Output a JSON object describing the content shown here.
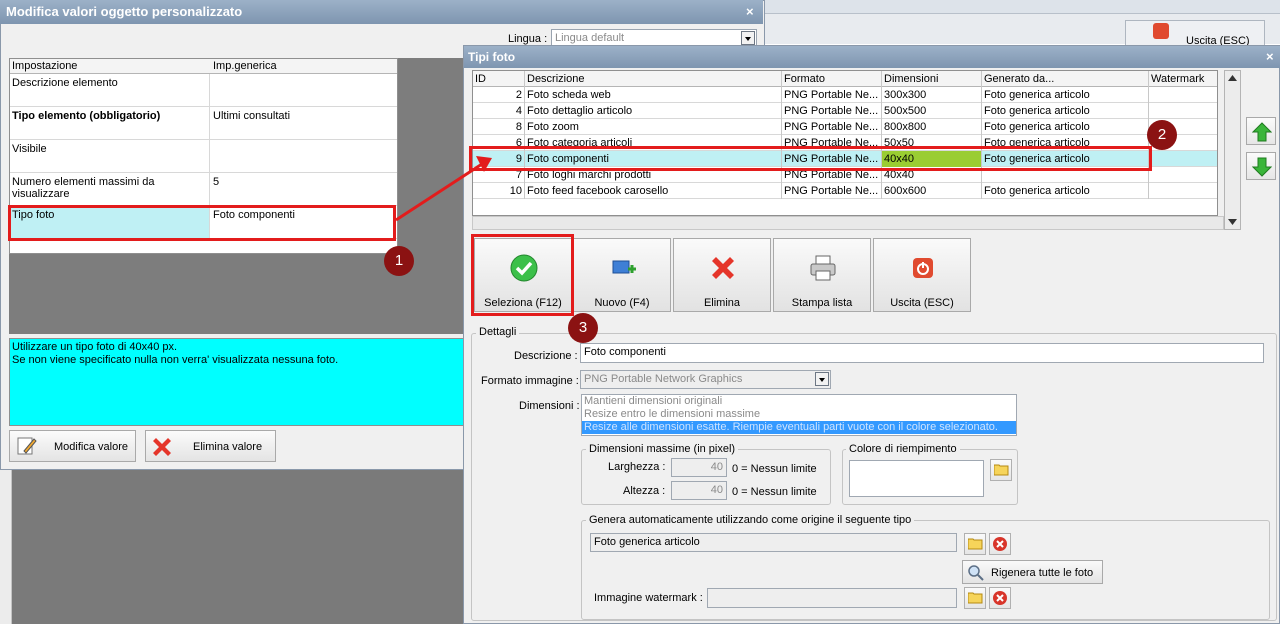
{
  "colors": {
    "accent_red": "#e31c1c",
    "badge": "#8b1212",
    "highlight_cyan": "#00ffff",
    "selected_row": "#bff0f4",
    "dim_highlight": "#9acd32"
  },
  "background": {
    "exit_label": "Uscita (ESC)"
  },
  "left_window": {
    "title": "Modifica valori oggetto personalizzato",
    "close_icon": "×",
    "lingua_label": "Lingua :",
    "lingua_value": "Lingua default",
    "grid": {
      "headers": [
        "Impostazione",
        "Imp.generica"
      ],
      "rows": [
        {
          "key": "Descrizione elemento",
          "value": ""
        },
        {
          "key": "Tipo elemento (obbligatorio)",
          "value": "Ultimi consultati"
        },
        {
          "key": "Visibile",
          "value": ""
        },
        {
          "key": "Numero elementi massimi da visualizzare",
          "value": "5"
        },
        {
          "key": "Tipo foto",
          "value": "Foto componenti"
        }
      ]
    },
    "description_lines": [
      "Utilizzare un tipo foto di 40x40 px.",
      "Se non viene specificato nulla non verra' visualizzata nessuna foto."
    ],
    "buttons": {
      "modify": "Modifica valore",
      "delete": "Elimina valore"
    }
  },
  "right_window": {
    "title": "Tipi foto",
    "close_icon": "×",
    "grid": {
      "headers": [
        "ID",
        "Descrizione",
        "Formato",
        "Dimensioni",
        "Generato da...",
        "Watermark"
      ],
      "rows": [
        {
          "id": "2",
          "desc": "Foto scheda web",
          "format": "PNG Portable Ne...",
          "dim": "300x300",
          "gen": "Foto generica articolo",
          "wm": ""
        },
        {
          "id": "4",
          "desc": "Foto dettaglio articolo",
          "format": "PNG Portable Ne...",
          "dim": "500x500",
          "gen": "Foto generica articolo",
          "wm": ""
        },
        {
          "id": "8",
          "desc": "Foto zoom",
          "format": "PNG Portable Ne...",
          "dim": "800x800",
          "gen": "Foto generica articolo",
          "wm": ""
        },
        {
          "id": "6",
          "desc": "Foto categoria articoli",
          "format": "PNG Portable Ne...",
          "dim": "50x50",
          "gen": "Foto generica articolo",
          "wm": ""
        },
        {
          "id": "9",
          "desc": "Foto componenti",
          "format": "PNG Portable Ne...",
          "dim": "40x40",
          "gen": "Foto generica articolo",
          "wm": ""
        },
        {
          "id": "7",
          "desc": "Foto loghi marchi prodotti",
          "format": "PNG Portable Ne...",
          "dim": "40x40",
          "gen": "",
          "wm": ""
        },
        {
          "id": "10",
          "desc": "Foto feed facebook carosello",
          "format": "PNG Portable Ne...",
          "dim": "600x600",
          "gen": "Foto generica articolo",
          "wm": ""
        }
      ]
    },
    "toolbar": {
      "select": "Seleziona (F12)",
      "new": "Nuovo (F4)",
      "delete": "Elimina",
      "print": "Stampa lista",
      "exit": "Uscita (ESC)"
    },
    "details": {
      "group_label": "Dettagli",
      "description_label": "Descrizione :",
      "description_value": "Foto componenti",
      "format_label": "Formato immagine :",
      "format_value": "PNG Portable Network Graphics",
      "dimensions_label": "Dimensioni :",
      "dimension_options": [
        "Mantieni dimensioni originali",
        "Resize entro le dimensioni massime",
        "Resize alle dimensioni esatte. Riempie eventuali parti vuote con il colore selezionato."
      ],
      "max_dim_label": "Dimensioni massime (in pixel)",
      "width_label": "Larghezza :",
      "width_value": "40",
      "height_label": "Altezza :",
      "height_value": "40",
      "no_limit": "0 = Nessun limite",
      "fill_color_label": "Colore di riempimento",
      "auto_gen_label": "Genera automaticamente utilizzando come origine il seguente tipo",
      "auto_gen_value": "Foto generica articolo",
      "regen_label": "Rigenera tutte le foto",
      "watermark_label": "Immagine watermark :"
    }
  },
  "badges": [
    "1",
    "2",
    "3"
  ]
}
